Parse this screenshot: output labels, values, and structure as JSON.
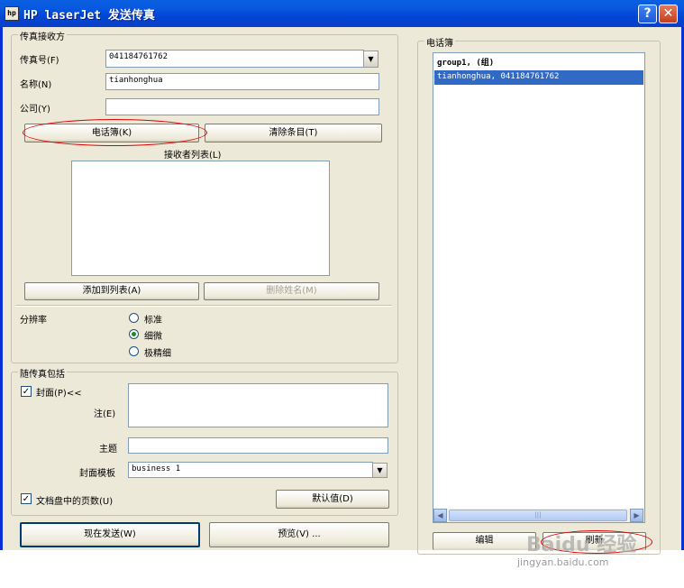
{
  "window": {
    "title": "HP laserJet 发送传真",
    "icon_text": "hp",
    "help_glyph": "?",
    "close_glyph": "✕"
  },
  "recipient": {
    "group_label": "传真接收方",
    "fax_label": "传真号(F)",
    "fax_value": "041184761762",
    "name_label": "名称(N)",
    "name_value": "tianhonghua",
    "company_label": "公司(Y)",
    "company_value": "",
    "phonebook_button": "电话簿(K)",
    "clear_button": "清除条目(T)",
    "list_label": "接收者列表(L)",
    "add_button": "添加到列表(A)",
    "remove_button": "删除姓名(M)",
    "resolution_label": "分辨率",
    "resolutions": [
      {
        "label": "标准",
        "selected": false
      },
      {
        "label": "细微",
        "selected": true
      },
      {
        "label": "极精细",
        "selected": false
      }
    ]
  },
  "include": {
    "group_label": "随传真包括",
    "cover_label": "封面(P)<<",
    "cover_checked": true,
    "note_label": "注(E)",
    "subject_label": "主题",
    "template_label": "封面模板",
    "template_value": "business 1",
    "pages_label": "文档盘中的页数(U)",
    "pages_checked": true,
    "default_button": "默认值(D)"
  },
  "actions": {
    "send_button": "现在发送(W)",
    "preview_button": "预览(V) ..."
  },
  "phonebook": {
    "group_label": "电话簿",
    "entries": [
      {
        "text": "group1,   (组)",
        "selected": false
      },
      {
        "text": "tianhonghua, 041184761762",
        "selected": true
      }
    ],
    "scroll_glyph": "|||",
    "edit_button": "编辑",
    "refresh_button": "刷新"
  },
  "watermark": {
    "brand": "Baidu 经验",
    "url": "jingyan.baidu.com"
  },
  "annotation_color": "#e00000"
}
